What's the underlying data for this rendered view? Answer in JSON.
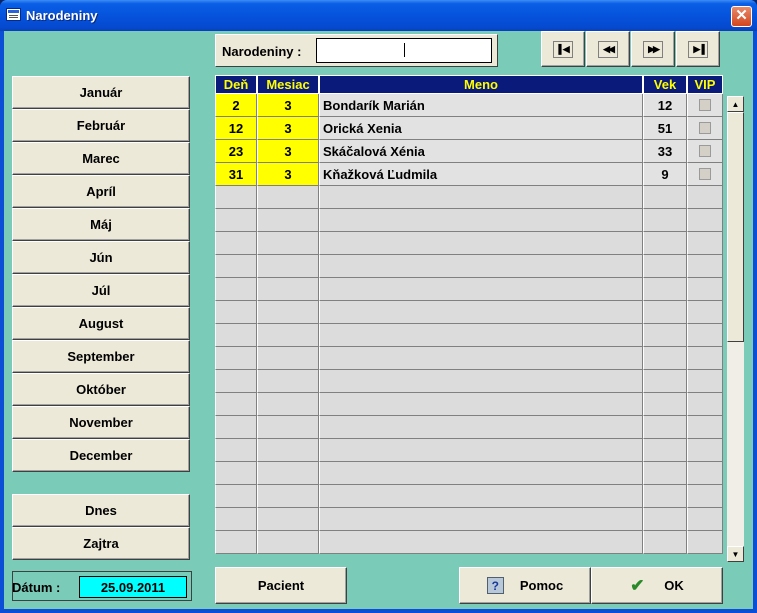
{
  "window": {
    "title": "Narodeniny",
    "close_glyph": "✕"
  },
  "months": [
    "Január",
    "Február",
    "Marec",
    "Apríl",
    "Máj",
    "Jún",
    "Júl",
    "August",
    "September",
    "Október",
    "November",
    "December"
  ],
  "quick": {
    "today": "Dnes",
    "tomorrow": "Zajtra"
  },
  "date": {
    "label": "Dátum :",
    "value": "25.09.2011"
  },
  "search": {
    "label": "Narodeniny :",
    "value": ""
  },
  "nav": {
    "first": "first-record-icon",
    "prev": "previous-record-icon",
    "next": "next-record-icon",
    "last": "last-record-icon"
  },
  "table": {
    "headers": {
      "day": "Deň",
      "month": "Mesiac",
      "name": "Meno",
      "age": "Vek",
      "vip": "VIP"
    },
    "rows": [
      {
        "day": "2",
        "month": "3",
        "name": "Bondarík Marián",
        "age": "12",
        "vip": false
      },
      {
        "day": "12",
        "month": "3",
        "name": "Orická Xenia",
        "age": "51",
        "vip": false
      },
      {
        "day": "23",
        "month": "3",
        "name": "Skáčalová Xénia",
        "age": "33",
        "vip": false
      },
      {
        "day": "31",
        "month": "3",
        "name": "Kňažková Ľudmila",
        "age": "9",
        "vip": false
      }
    ]
  },
  "buttons": {
    "patient": "Pacient",
    "help": "Pomoc",
    "ok": "OK"
  },
  "icons": {
    "help": "?",
    "ok": "✔"
  }
}
